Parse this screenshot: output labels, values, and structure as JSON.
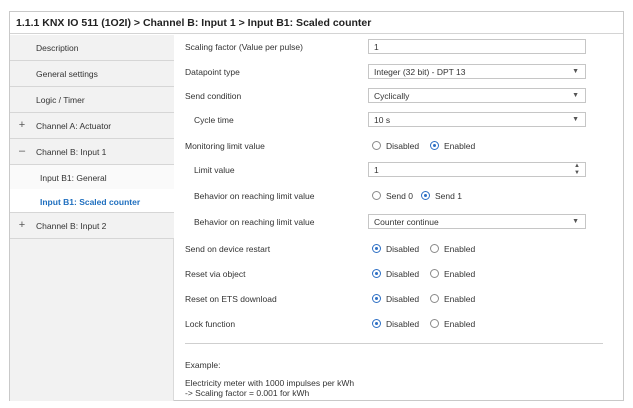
{
  "breadcrumb": "1.1.1 KNX IO 511 (1O2I) > Channel B: Input 1 > Input B1: Scaled counter",
  "sidebar": {
    "items": [
      {
        "label": "Description",
        "symbol": ""
      },
      {
        "label": "General settings",
        "symbol": ""
      },
      {
        "label": "Logic / Timer",
        "symbol": ""
      },
      {
        "label": "Channel A: Actuator",
        "symbol": "+"
      },
      {
        "label": "Channel B: Input 1",
        "symbol": "–"
      },
      {
        "label": "Input B1: General",
        "symbol": ""
      },
      {
        "label": "Input B1: Scaled counter",
        "symbol": "",
        "active": true
      },
      {
        "label": "Channel B: Input 2",
        "symbol": "+"
      }
    ]
  },
  "params": {
    "scaling_factor": {
      "label": "Scaling factor (Value per pulse)",
      "value": "1"
    },
    "datapoint_type": {
      "label": "Datapoint type",
      "value": "Integer (32 bit) - DPT 13"
    },
    "send_condition": {
      "label": "Send condition",
      "value": "Cyclically"
    },
    "cycle_time": {
      "label": "Cycle time",
      "value": "10 s"
    },
    "monitoring_limit": {
      "label": "Monitoring limit value",
      "options": [
        "Disabled",
        "Enabled"
      ],
      "selected": "Enabled"
    },
    "limit_value": {
      "label": "Limit value",
      "value": "1"
    },
    "behavior_limit_send": {
      "label": "Behavior on reaching limit value",
      "options": [
        "Send 0",
        "Send 1"
      ],
      "selected": "Send 1"
    },
    "behavior_limit_counter": {
      "label": "Behavior on reaching limit value",
      "value": "Counter continue"
    },
    "send_on_restart": {
      "label": "Send on device restart",
      "options": [
        "Disabled",
        "Enabled"
      ],
      "selected": "Disabled"
    },
    "reset_via_object": {
      "label": "Reset via object",
      "options": [
        "Disabled",
        "Enabled"
      ],
      "selected": "Disabled"
    },
    "reset_on_ets": {
      "label": "Reset on ETS download",
      "options": [
        "Disabled",
        "Enabled"
      ],
      "selected": "Disabled"
    },
    "lock_function": {
      "label": "Lock function",
      "options": [
        "Disabled",
        "Enabled"
      ],
      "selected": "Disabled"
    }
  },
  "example": {
    "heading": "Example:",
    "line1": "Electricity meter with 1000 impulses per kWh",
    "line2": "-> Scaling factor = 0.001 for kWh"
  },
  "icons": {
    "dropdown": "chevron-down-icon",
    "spinner": "spinner-arrows-icon"
  },
  "colors": {
    "accent": "#2d6fc4",
    "active_nav": "#1f6fbf"
  }
}
